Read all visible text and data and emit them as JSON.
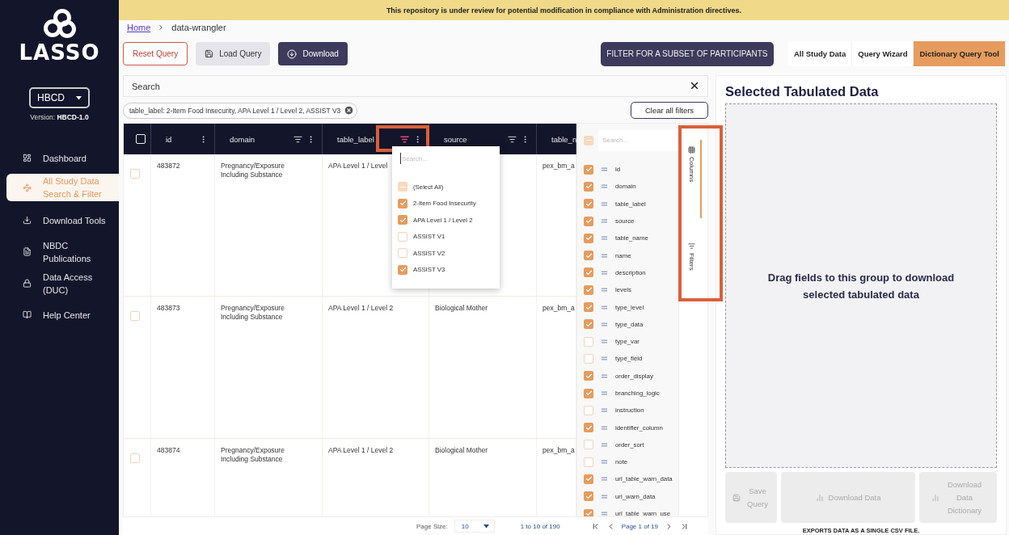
{
  "banner": "This repository is under review for potential modification in compliance with Administration directives.",
  "sidebar": {
    "logo": "LASSO",
    "study": "HBCD",
    "version_label": "Version:",
    "version": "HBCD-1.0",
    "items": [
      {
        "label": "Dashboard",
        "kind": "dashboard",
        "selected": false
      },
      {
        "label": "All Study Data Search & Filter",
        "kind": "explore",
        "selected": true
      },
      {
        "label": "Download Tools",
        "kind": "download",
        "selected": false
      },
      {
        "label": "NBDC Publications",
        "kind": "publication",
        "selected": false
      },
      {
        "label": "Data Access (DUC)",
        "kind": "lock",
        "selected": false
      },
      {
        "label": "Help Center",
        "kind": "help",
        "selected": false
      }
    ]
  },
  "breadcrumb": [
    "Home",
    "data-wrangler"
  ],
  "toolbar": [
    {
      "label": "Reset Query",
      "kind": "reset"
    },
    {
      "label": "Load Query",
      "kind": "load"
    },
    {
      "label": "Download",
      "kind": "download"
    }
  ],
  "filter_subset_button": "FILTER FOR A SUBSET OF PARTICIPANTS",
  "view_tabs": [
    {
      "label": "All Study Data",
      "selected": false
    },
    {
      "label": "Query Wizard",
      "selected": false
    },
    {
      "label": "Dictionary Query Tool",
      "selected": true
    }
  ],
  "search": {
    "placeholder": "Search"
  },
  "filter_chip": "table_label: 2-Item Food Insecurity, APA Level 1 / Level 2, ASSIST V3",
  "clear_filters": "Clear all filters",
  "table": {
    "header_checked": false,
    "columns": [
      {
        "label": "id",
        "filter": false,
        "highlighted": false
      },
      {
        "label": "domain",
        "filter": true,
        "filter_active": false,
        "highlighted": false
      },
      {
        "label": "table_label",
        "filter": true,
        "filter_active": true,
        "highlighted": true
      },
      {
        "label": "source",
        "filter": true,
        "filter_active": false,
        "highlighted": false
      }
    ],
    "cut_column": "table_n",
    "rows": [
      {
        "checked": false,
        "cells": [
          "483872",
          "Pregnancy/Exposure Including Substance",
          "APA Level 1 / Level",
          null,
          "pex_bm_a"
        ]
      },
      {
        "checked": false,
        "cells": [
          "483873",
          "Pregnancy/Exposure Including Substance",
          "APA Level 1 / Level 2",
          "Biological Mother",
          "pex_bm_a"
        ]
      },
      {
        "checked": false,
        "cells": [
          "483874",
          "Pregnancy/Exposure Including Substance",
          "APA Level 1 / Level 2",
          "Biological Mother",
          "pex_bm_a"
        ]
      }
    ]
  },
  "filter_popup": {
    "placeholder": "Search...",
    "select_all": {
      "label": "(Select All)",
      "indeterminate": true
    },
    "options": [
      {
        "label": "2-Item Food Insecurity",
        "checked": true
      },
      {
        "label": "APA Level 1 / Level 2",
        "checked": true
      },
      {
        "label": "ASSIST V1",
        "checked": false
      },
      {
        "label": "ASSIST V2",
        "checked": false
      },
      {
        "label": "ASSIST V3",
        "checked": true
      }
    ]
  },
  "column_panel": {
    "select_all_indeterminate": true,
    "placeholder": "Search...",
    "items": [
      {
        "label": "id",
        "checked": true
      },
      {
        "label": "domain",
        "checked": true
      },
      {
        "label": "table_label",
        "checked": true
      },
      {
        "label": "source",
        "checked": true
      },
      {
        "label": "table_name",
        "checked": true
      },
      {
        "label": "name",
        "checked": true
      },
      {
        "label": "description",
        "checked": true
      },
      {
        "label": "levels",
        "checked": true
      },
      {
        "label": "type_level",
        "checked": true
      },
      {
        "label": "type_data",
        "checked": true
      },
      {
        "label": "type_var",
        "checked": false
      },
      {
        "label": "type_field",
        "checked": false
      },
      {
        "label": "order_display",
        "checked": true
      },
      {
        "label": "branching_logic",
        "checked": true
      },
      {
        "label": "instruction",
        "checked": false
      },
      {
        "label": "identifier_column",
        "checked": true
      },
      {
        "label": "order_sort",
        "checked": false
      },
      {
        "label": "note",
        "checked": false
      },
      {
        "label": "url_table_warn_data",
        "checked": true
      },
      {
        "label": "url_warn_data",
        "checked": true
      },
      {
        "label": "url_table_warn_use",
        "checked": true
      }
    ]
  },
  "side_tabs_highlighted": true,
  "side_tabs": [
    {
      "label": "Columns",
      "kind": "columns",
      "selected": true
    },
    {
      "label": "Filters",
      "kind": "filters",
      "selected": false
    }
  ],
  "pagination": {
    "page_size_label": "Page Size:",
    "page_size": "10",
    "range": "1 to 10 of 190",
    "page": "Page 1 of 19"
  },
  "selected_panel": {
    "title": "Selected Tabulated Data",
    "dropzone": "Drag fields to this group to download selected tabulated data",
    "buttons": [
      {
        "label": "Save Query",
        "kind": "save",
        "disabled": true
      },
      {
        "label": "Download Data",
        "kind": "chart",
        "disabled": true
      },
      {
        "label": "Download Data Dictionary",
        "kind": "chart",
        "disabled": true
      }
    ],
    "caption": "EXPORTS DATA AS A SINGLE CSV FILE."
  }
}
